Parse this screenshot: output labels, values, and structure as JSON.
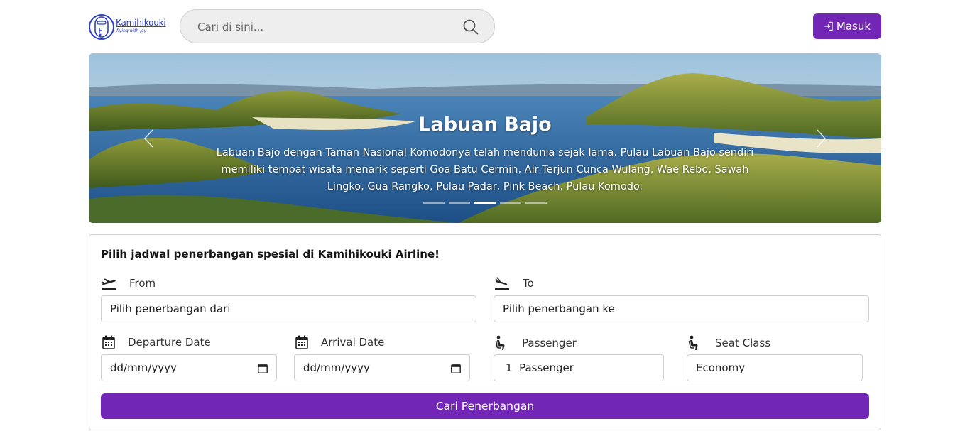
{
  "header": {
    "brand": "Kamihikouki",
    "tagline": "flying with joy",
    "search_placeholder": "Cari di sini...",
    "login_label": "Masuk"
  },
  "hero": {
    "title": "Labuan Bajo",
    "description": "Labuan Bajo dengan Taman Nasional Komodonya telah mendunia sejak lama. Pulau Labuan Bajo sendiri memiliki tempat wisata menarik seperti Goa Batu Cermin, Air Terjun Cunca Wulang, Wae Rebo, Sawah Lingko, Gua Rangko, Pulau Padar, Pink Beach, Pulau Komodo.",
    "slide_count": 5,
    "active_slide": 3
  },
  "form": {
    "heading": "Pilih jadwal penerbangan spesial di Kamihikouki Airline!",
    "from_label": "From",
    "from_value": "Pilih penerbangan dari",
    "to_label": "To",
    "to_value": "Pilih penerbangan ke",
    "departure_label": "Departure Date",
    "departure_value": "dd/mm/yyyy",
    "arrival_label": "Arrival Date",
    "arrival_value": "dd/mm/yyyy",
    "passenger_label": "Passenger",
    "passenger_value": "1  Passenger",
    "seat_label": "Seat Class",
    "seat_value": "Economy",
    "submit_label": "Cari Penerbangan"
  },
  "colors": {
    "accent": "#7126b5",
    "brand_blue": "#2b3fc9"
  },
  "icons": [
    "logo-icon",
    "search-icon",
    "login-icon",
    "takeoff-icon",
    "landing-icon",
    "calendar-icon",
    "seat-icon",
    "chevron-left-icon",
    "chevron-right-icon"
  ]
}
